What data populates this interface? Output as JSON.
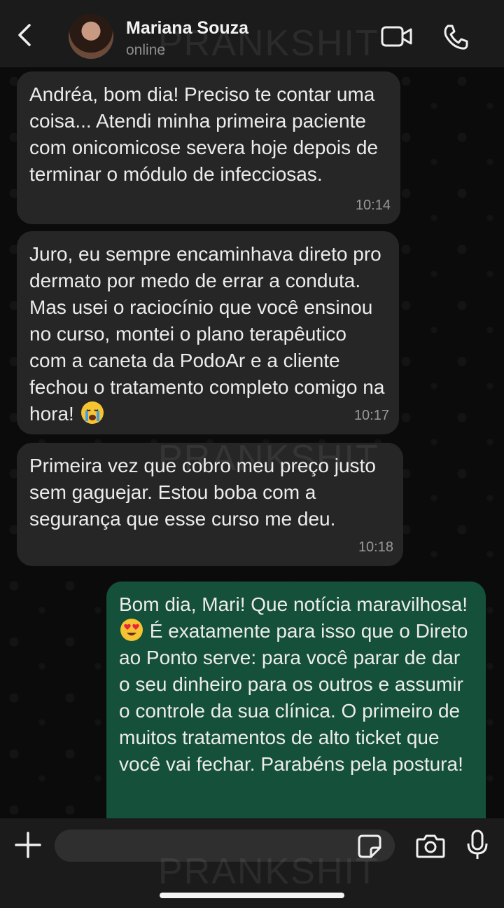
{
  "header": {
    "contact_name": "Mariana Souza",
    "status": "online",
    "back_icon": "chevron-left-icon",
    "video_icon": "video-camera-icon",
    "call_icon": "phone-icon"
  },
  "watermark": "PRANKSHIT",
  "messages": [
    {
      "direction": "incoming",
      "text_before": "Andréa, bom dia! Preciso te contar uma coisa... Atendi minha primeira paciente com onicomicose severa hoje depois de terminar o módulo de infecciosas.",
      "time": "10:14"
    },
    {
      "direction": "incoming",
      "text_before": "Juro, eu sempre encaminhava direto pro dermato por medo de errar a conduta. Mas usei o raciocínio que você ensinou no curso, montei o plano terapêutico com a caneta da PodoAr e a cliente fechou o tratamento completo comigo na hora!",
      "emoji": "crying-face-emoji",
      "time": "10:17"
    },
    {
      "direction": "incoming",
      "text_before": "Primeira vez que cobro meu preço justo sem gaguejar. Estou boba com a segurança que esse curso me deu.",
      "time": "10:18"
    },
    {
      "direction": "outgoing",
      "text_before": "Bom dia, Mari! Que notícia maravilhosa!",
      "emoji": "heart-eyes-emoji",
      "text_after": "É exatamente para isso que o Direto ao Ponto serve: para você parar de dar o seu dinheiro para os outros e assumir o controle da sua clínica. O primeiro de muitos tratamentos de alto ticket que você vai fechar. Parabéns pela postura!"
    }
  ],
  "composer": {
    "plus_icon": "plus-icon",
    "sticker_icon": "sticker-icon",
    "camera_icon": "camera-icon",
    "mic_icon": "microphone-icon"
  },
  "colors": {
    "incoming_bubble": "#262626",
    "outgoing_bubble": "#15503a",
    "header_bg": "#1b1b1b"
  }
}
